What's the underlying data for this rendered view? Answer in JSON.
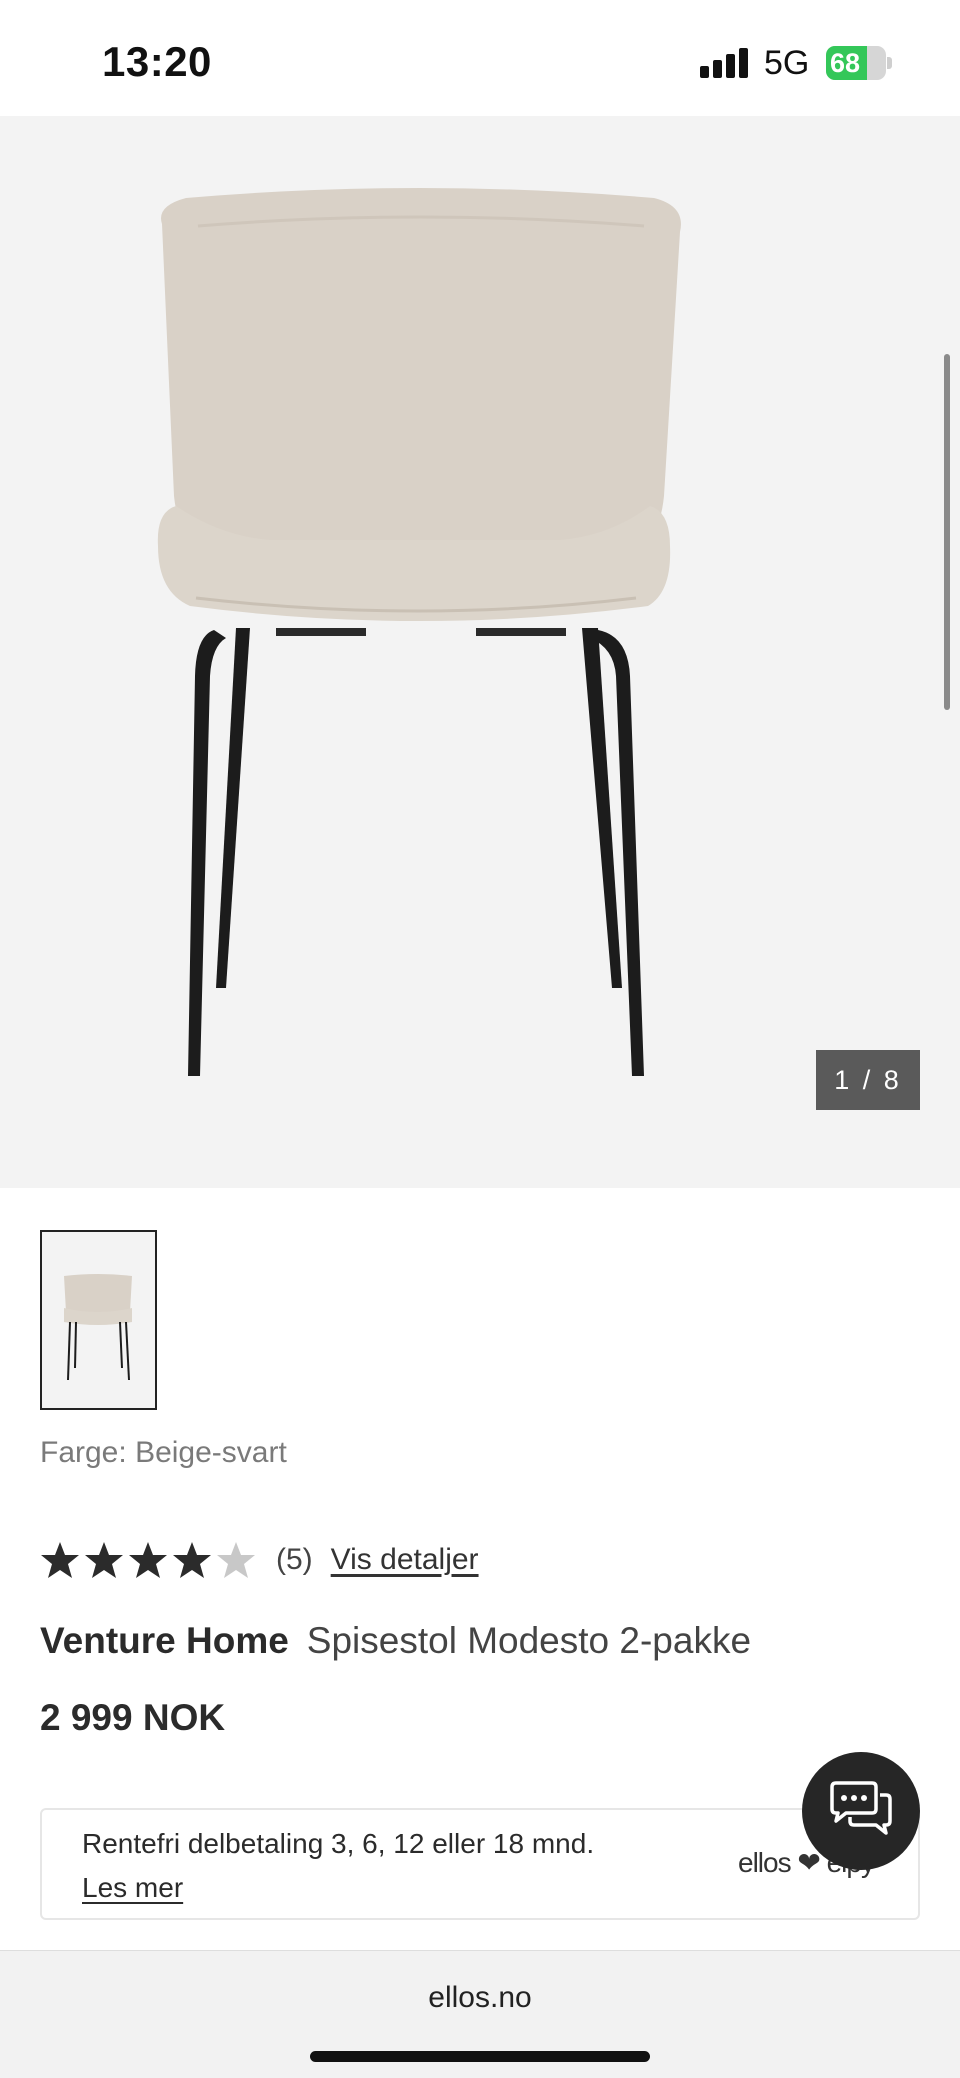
{
  "status_bar": {
    "time": "13:20",
    "network": "5G",
    "battery_percent": "68",
    "battery_level": 0.68,
    "battery_color": "#34c759"
  },
  "gallery": {
    "counter": "1 / 8"
  },
  "product": {
    "color_label": "Farge:",
    "color_value": "Beige-svart",
    "rating": 4,
    "rating_max": 5,
    "review_count": "(5)",
    "details_link": "Vis detaljer",
    "brand": "Venture Home",
    "name": "Spisestol Modesto 2-pakke",
    "price": "2 999 NOK"
  },
  "finance": {
    "text": "Rentefri delbetaling 3, 6, 12 eller 18 mnd.",
    "link": "Les mer",
    "logo_text": "ellos ❤ elpy"
  },
  "chat": {
    "icon": "chat-bubbles-icon"
  },
  "browser": {
    "url": "ellos.no"
  },
  "colors": {
    "star_filled": "#2b2b2b",
    "star_empty": "#c8c8c8",
    "fabric": "#d8d0c6",
    "legs": "#1c1c1c"
  }
}
